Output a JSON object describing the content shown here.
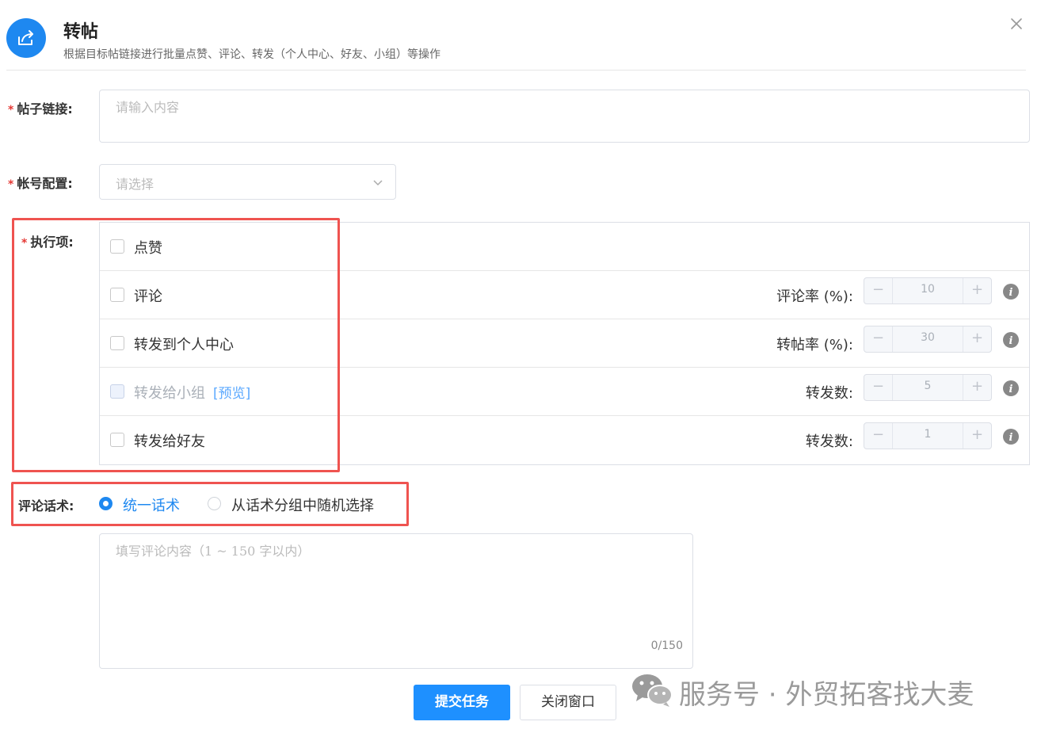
{
  "header": {
    "title": "转帖",
    "subtitle": "根据目标帖链接进行批量点赞、评论、转发（个人中心、好友、小组）等操作",
    "app_icon": "share-arrow-icon",
    "close_icon": "close-icon",
    "accent_color": "#1e88f0"
  },
  "form": {
    "post_link": {
      "label": "帖子链接:",
      "placeholder": "请输入内容",
      "value": ""
    },
    "account_config": {
      "label": "帐号配置:",
      "placeholder": "请选择",
      "selected": ""
    },
    "execution": {
      "label": "执行项:",
      "items": [
        {
          "label": "点赞",
          "checked": false,
          "disabled": false
        },
        {
          "label": "评论",
          "checked": false,
          "disabled": false,
          "rate_label": "评论率 (%):",
          "value": "10",
          "minus": "−",
          "plus": "+"
        },
        {
          "label": "转发到个人中心",
          "checked": false,
          "disabled": false,
          "rate_label": "转帖率 (%):",
          "value": "30",
          "minus": "−",
          "plus": "+"
        },
        {
          "label": "转发给小组",
          "checked": false,
          "disabled": true,
          "link": "[预览]",
          "rate_label": "转发数:",
          "value": "5",
          "minus": "−",
          "plus": "+"
        },
        {
          "label": "转发给好友",
          "checked": false,
          "disabled": false,
          "rate_label": "转发数:",
          "value": "1",
          "minus": "−",
          "plus": "+"
        }
      ]
    },
    "comment_script": {
      "label": "评论话术:",
      "options": [
        {
          "label": "统一话术",
          "selected": true
        },
        {
          "label": "从话术分组中随机选择",
          "selected": false
        }
      ],
      "textarea_placeholder": "填写评论内容（1 ~ 150 字以内）",
      "char_count": "0/150"
    }
  },
  "buttons": {
    "submit": "提交任务",
    "close": "关闭窗口"
  },
  "watermark": {
    "text": "服务号 · 外贸拓客找大麦",
    "icon": "wechat-icon"
  },
  "colors": {
    "primary": "#1e90ff",
    "required": "#e53935",
    "highlight": "#ef5350"
  }
}
